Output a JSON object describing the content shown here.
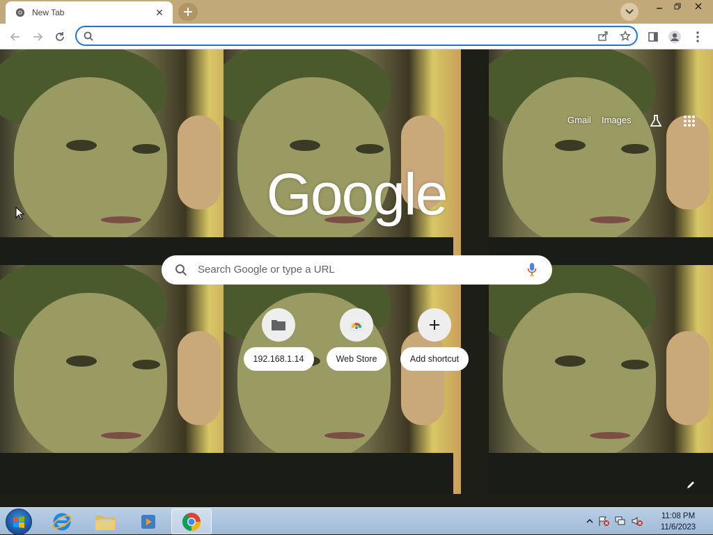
{
  "browser": {
    "tab": {
      "title": "New Tab",
      "close_icon": "close-icon"
    },
    "new_tab_icon": "plus-icon",
    "tab_search_icon": "chevron-down-icon",
    "window_controls": [
      "minimize",
      "restore",
      "close"
    ],
    "omnibox": {
      "value": "",
      "placeholder": ""
    },
    "accent_color": "#1a73e8",
    "frame_color": "#c2a979"
  },
  "ntp": {
    "links": {
      "gmail": "Gmail",
      "images": "Images"
    },
    "logo_text": "Google",
    "search_placeholder": "Search Google or type a URL",
    "shortcuts": [
      {
        "label": "192.168.1.14",
        "icon": "folder-icon"
      },
      {
        "label": "Web Store",
        "icon": "webstore-icon"
      },
      {
        "label": "Add shortcut",
        "icon": "plus-icon"
      }
    ]
  },
  "taskbar": {
    "apps": [
      "start-orb",
      "internet-explorer-icon",
      "file-explorer-icon",
      "media-player-icon",
      "chrome-icon"
    ],
    "active_app": "chrome-icon",
    "clock": {
      "time": "11:08 PM",
      "date": "11/6/2023"
    }
  }
}
